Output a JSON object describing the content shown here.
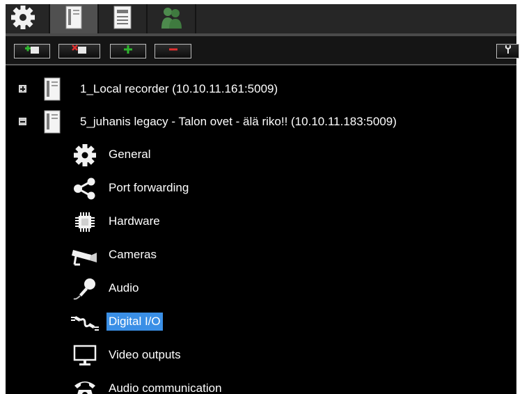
{
  "main_tabs": [
    {
      "icon": "gear-icon"
    },
    {
      "icon": "server-icon",
      "active": true
    },
    {
      "icon": "document-icon"
    },
    {
      "icon": "users-icon"
    }
  ],
  "toolbar": {
    "buttons": [
      {
        "name": "add-recorder-button",
        "icon": "server-add-icon"
      },
      {
        "name": "remove-recorder-button",
        "icon": "server-remove-icon"
      },
      {
        "name": "add-button",
        "icon": "plus-icon"
      },
      {
        "name": "remove-button",
        "icon": "minus-icon"
      },
      {
        "name": "tools-button",
        "icon": "wrench-icon"
      }
    ]
  },
  "tree": {
    "recorders": [
      {
        "label": "1_Local recorder (10.10.11.161:5009)",
        "expanded": false
      },
      {
        "label": "5_juhanis legacy - Talon ovet - älä riko!! (10.10.11.183:5009)",
        "expanded": true,
        "children": [
          {
            "label": "General",
            "icon": "gear-icon"
          },
          {
            "label": "Port forwarding",
            "icon": "share-icon"
          },
          {
            "label": "Hardware",
            "icon": "chip-icon"
          },
          {
            "label": "Cameras",
            "icon": "camera-icon"
          },
          {
            "label": "Audio",
            "icon": "microphone-icon"
          },
          {
            "label": "Digital I/O",
            "icon": "cable-icon",
            "selected": true
          },
          {
            "label": "Video outputs",
            "icon": "monitor-icon"
          },
          {
            "label": "Audio communication",
            "icon": "telephone-icon"
          }
        ]
      }
    ]
  },
  "colors": {
    "selection": "#3a8fe6",
    "add_green": "#2fb52f",
    "remove_red": "#e03030"
  }
}
